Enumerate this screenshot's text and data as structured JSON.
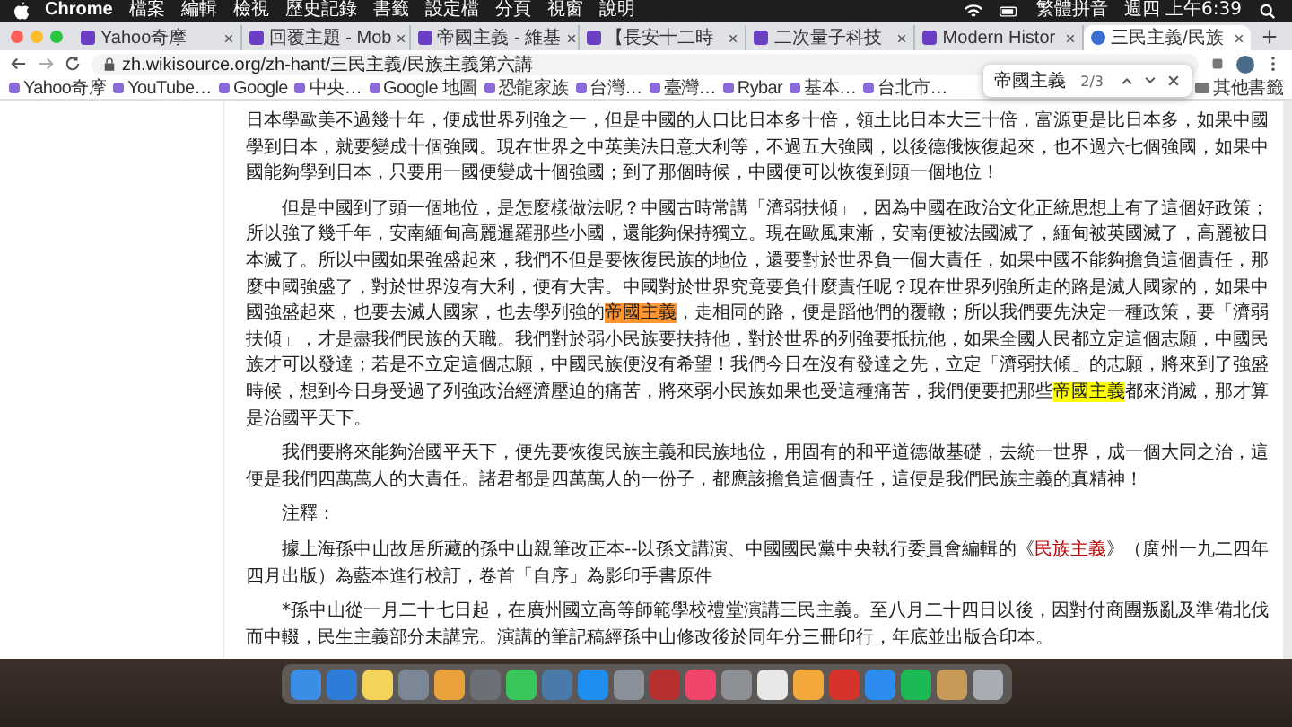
{
  "menubar": {
    "app": "Chrome",
    "menus": [
      "檔案",
      "編輯",
      "檢視",
      "歷史記錄",
      "書籤",
      "設定檔",
      "分頁",
      "視窗",
      "說明"
    ],
    "input_method": "繁體拼音",
    "clock": "週四 上午6:39"
  },
  "tabs": [
    {
      "title": "Yahoo奇摩",
      "selected": false
    },
    {
      "title": "回覆主題 - Mob",
      "selected": false
    },
    {
      "title": "帝國主義 - 維基",
      "selected": false
    },
    {
      "title": "【長安十二時",
      "selected": false
    },
    {
      "title": "二次量子科技",
      "selected": false
    },
    {
      "title": "Modern Histor",
      "selected": false
    },
    {
      "title": "三民主義/民族",
      "selected": true
    }
  ],
  "address": {
    "url": "zh.wikisource.org/zh-hant/三民主義/民族主義第六講"
  },
  "bookmarks": [
    "Yahoo奇摩",
    "YouTube…",
    "Google",
    "中央…",
    "Google 地圖",
    "恐龍家族",
    "台灣…",
    "臺灣…",
    "Rybar",
    "基本…",
    "台北市…"
  ],
  "other_bookmarks": "其他書籤",
  "find_bar": {
    "query": "帝國主義",
    "count": "2/3"
  },
  "paragraphs": [
    {
      "indent": false,
      "segments": [
        {
          "kind": "text",
          "text": "日本學歐美不過幾十年，便成世界列強之一，但是中國的人口比日本多十倍，領土比日本大三十倍，富源更是比日本多，如果中國學到日本，就要變成十個強國。現在世界之中英美法日意大利等，不過五大強國，以後德俄恢復起來，也不過六七個強國，如果中國能夠學到日本，只要用一國便變成十個強國；到了那個時候，中國便可以恢復到頭一個地位！"
        }
      ]
    },
    {
      "indent": true,
      "segments": [
        {
          "kind": "text",
          "text": "但是中國到了頭一個地位，是怎麼樣做法呢？中國古時常講「濟弱扶傾」，因為中國在政治文化正統思想上有了這個好政策；所以強了幾千年，安南緬甸高麗暹羅那些小國，還能夠保持獨立。現在歐風東漸，安南便被法國滅了，緬甸被英國滅了，高麗被日本滅了。所以中國如果強盛起來，我們不但是要恢復民族的地位，還要對於世界負一個大責任，如果中國不能夠擔負這個責任，那麼中國強盛了，對於世界沒有大利，便有大害。中國對於世界究竟要負什麼責任呢？現在世界列強所走的路是滅人國家的，如果中國強盛起來，也要去滅人國家，也去學列強的"
        },
        {
          "kind": "current",
          "text": "帝國主義"
        },
        {
          "kind": "text",
          "text": "，走相同的路，便是蹈他們的覆轍；所以我們要先決定一種政策，要「濟弱扶傾」，才是盡我們民族的天職。我們對於弱小民族要扶持他，對於世界的列強要抵抗他，如果全國人民都立定這個志願，中國民族才可以發達；若是不立定這個志願，中國民族便沒有希望！我們今日在沒有發達之先，立定「濟弱扶傾」的志願，將來到了強盛時候，想到今日身受過了列強政治經濟壓迫的痛苦，將來弱小民族如果也受這種痛苦，我們便要把那些"
        },
        {
          "kind": "match",
          "text": "帝國主義"
        },
        {
          "kind": "text",
          "text": "都來消滅，那才算是治國平天下。"
        }
      ]
    },
    {
      "indent": true,
      "segments": [
        {
          "kind": "text",
          "text": "我們要將來能夠治國平天下，便先要恢復民族主義和民族地位，用固有的和平道德做基礎，去統一世界，成一個大同之治，這便是我們四萬萬人的大責任。諸君都是四萬萬人的一份子，都應該擔負這個責任，這便是我們民族主義的真精神！"
        }
      ]
    },
    {
      "indent": true,
      "segments": [
        {
          "kind": "text",
          "text": "注釋："
        }
      ]
    },
    {
      "indent": true,
      "segments": [
        {
          "kind": "text",
          "text": "據上海孫中山故居所藏的孫中山親筆改正本--以孫文講演、中國國民黨中央執行委員會編輯的《"
        },
        {
          "kind": "link",
          "text": "民族主義"
        },
        {
          "kind": "text",
          "text": "》（廣州一九二四年四月出版）為藍本進行校訂，卷首「自序」為影印手書原件"
        }
      ]
    },
    {
      "indent": true,
      "segments": [
        {
          "kind": "text",
          "text": "*孫中山從一月二十七日起，在廣州國立高等師範學校禮堂演講三民主義。至八月二十四日以後，因對付商團叛亂及準備北伐而中輟，民生主義部分未講完。演講的筆記稿經孫中山修改後於同年分三冊印行，年底並出版合印本。"
        }
      ]
    }
  ]
}
